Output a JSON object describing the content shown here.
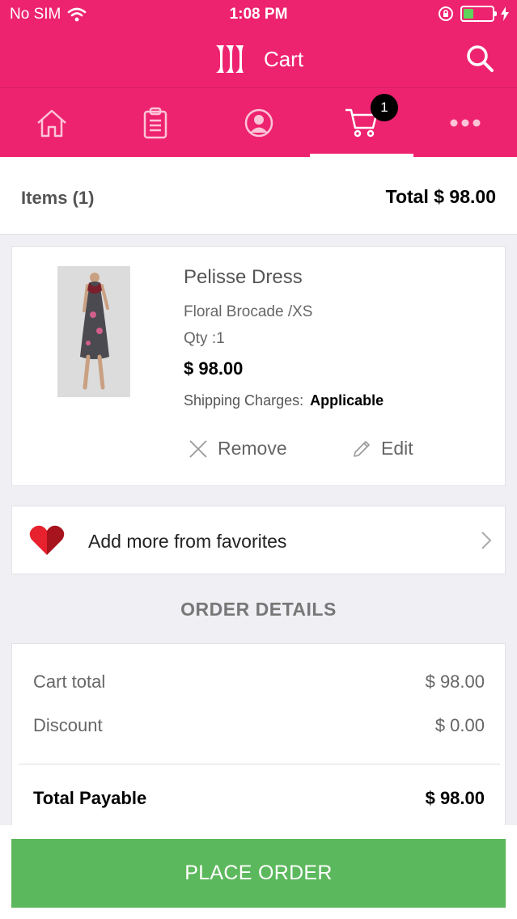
{
  "status_bar": {
    "carrier": "No SIM",
    "time": "1:08 PM"
  },
  "header": {
    "title": "Cart",
    "brand_color": "#ee2370"
  },
  "tabs": [
    {
      "icon": "home-icon"
    },
    {
      "icon": "orders-icon"
    },
    {
      "icon": "profile-icon"
    },
    {
      "icon": "cart-icon",
      "active": true,
      "badge": "1"
    },
    {
      "icon": "more-icon"
    }
  ],
  "summary": {
    "items_label": "Items (1)",
    "total_label": "Total  $ 98.00"
  },
  "cart_item": {
    "name": "Pelisse Dress",
    "variant": "Floral Brocade /XS",
    "qty": "Qty :1",
    "price": "$ 98.00",
    "shipping_label": "Shipping Charges:",
    "shipping_value": "Applicable",
    "remove_label": "Remove",
    "edit_label": "Edit"
  },
  "favorites": {
    "label": "Add more from favorites"
  },
  "order_details": {
    "title": "ORDER DETAILS",
    "cart_total_label": "Cart total",
    "cart_total_value": "$ 98.00",
    "discount_label": "Discount",
    "discount_value": "$ 0.00",
    "payable_label": "Total Payable",
    "payable_value": "$ 98.00"
  },
  "place_order": {
    "label": "PLACE ORDER",
    "color": "#5cb85c"
  }
}
